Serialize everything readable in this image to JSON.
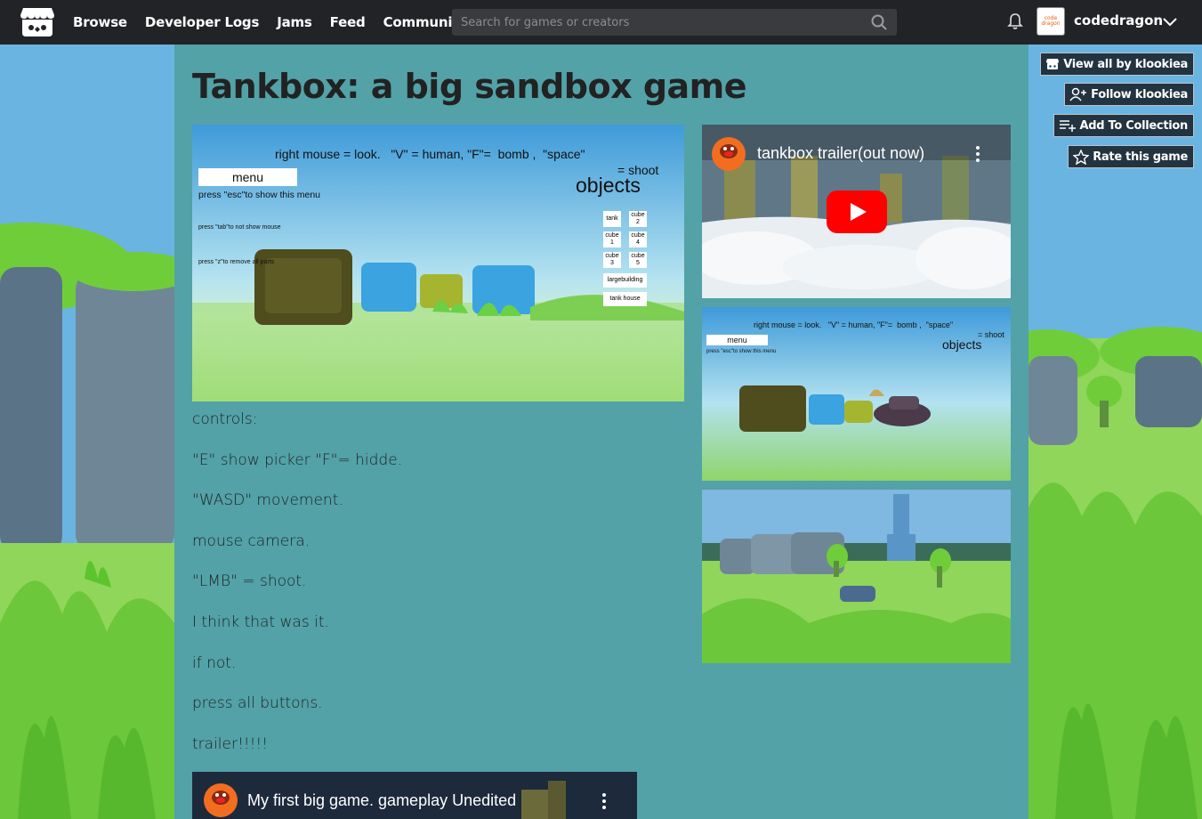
{
  "nav": {
    "links": [
      "Browse",
      "Developer Logs",
      "Jams",
      "Feed",
      "Community"
    ],
    "search_placeholder": "Search for games or creators",
    "username": "codedragon",
    "avatar_text": "code dragon"
  },
  "game": {
    "title": "Tankbox: a big sandbox game",
    "description": [
      "controls:",
      "\"E\" show picker \"F\"= hidde.",
      "\"WASD\" movement.",
      "mouse camera.",
      "\"LMB\" = shoot.",
      "I think that was it.",
      "if not.",
      "press all buttons.",
      "trailer!!!!!"
    ]
  },
  "screenshot": {
    "hud_controls": "right mouse = look.   \"V\" = human, \"F\"=  bomb ,  \"space\"",
    "hud_shoot": "= shoot",
    "menu_label": "menu",
    "esc_hint": "press \"esc\"to show this menu",
    "tab_hint": "press \"tab\"to not show mouse",
    "z_hint": "press \"z\"to remove all parts",
    "objects_title": "objects",
    "objects": [
      "tank",
      "cube 2",
      "cube 1",
      "cube 4",
      "cube 3",
      "cube 5"
    ],
    "largebuilding": "largebuilding",
    "tank_house": "tank house"
  },
  "videos": {
    "trailer_title": "tankbox trailer(out now)",
    "gameplay_title": "My first big game. gameplay Unedited"
  },
  "actions": {
    "view_all": "View all by klookiea",
    "follow": "Follow klookiea",
    "add_collection": "Add To Collection",
    "rate": "Rate this game"
  },
  "colors": {
    "page_bg": "#52a2a7",
    "nav_bg": "#222326",
    "button_bg": "#233440",
    "youtube_red": "#ff0000"
  }
}
